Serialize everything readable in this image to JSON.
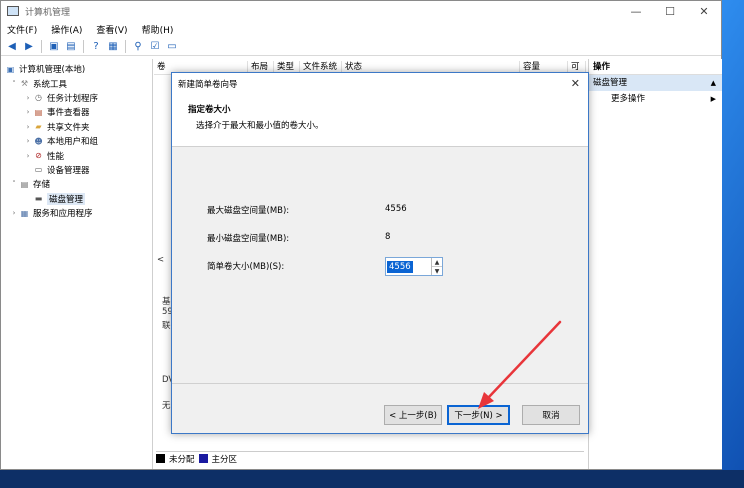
{
  "window": {
    "title": "计算机管理",
    "minimize": "—",
    "maximize": "☐",
    "close": "✕"
  },
  "menu": {
    "items": [
      "文件(F)",
      "操作(A)",
      "查看(V)",
      "帮助(H)"
    ]
  },
  "tree": {
    "items": [
      {
        "label": "计算机管理(本地)",
        "icon": "computer-icon",
        "level": 0,
        "arrow": ""
      },
      {
        "label": "系统工具",
        "icon": "tools-icon",
        "level": 1,
        "arrow": "˅"
      },
      {
        "label": "任务计划程序",
        "icon": "clock-icon",
        "level": 2,
        "arrow": "›"
      },
      {
        "label": "事件查看器",
        "icon": "event-icon",
        "level": 2,
        "arrow": "›"
      },
      {
        "label": "共享文件夹",
        "icon": "folder-icon",
        "level": 2,
        "arrow": "›"
      },
      {
        "label": "本地用户和组",
        "icon": "users-icon",
        "level": 2,
        "arrow": "›"
      },
      {
        "label": "性能",
        "icon": "performance-icon",
        "level": 2,
        "arrow": "›"
      },
      {
        "label": "设备管理器",
        "icon": "device-icon",
        "level": 2,
        "arrow": ""
      },
      {
        "label": "存储",
        "icon": "storage-icon",
        "level": 1,
        "arrow": "˅"
      },
      {
        "label": "磁盘管理",
        "icon": "disk-icon",
        "level": 2,
        "arrow": ""
      },
      {
        "label": "服务和应用程序",
        "icon": "services-icon",
        "level": 1,
        "arrow": "›"
      }
    ]
  },
  "center": {
    "columns": [
      "卷",
      "布局",
      "类型",
      "文件系统",
      "状态",
      "容量",
      "可"
    ],
    "fragments": {
      "left_arrow": "<",
      "disk_a": "基",
      "disk_b": "59",
      "disk_c": "联",
      "dvd": "DV",
      "none": "无"
    },
    "legend": {
      "unallocated": "未分配",
      "primary": "主分区",
      "unallocated_color": "#000000",
      "primary_color": "#1a1aa0"
    }
  },
  "actions": {
    "header": "操作",
    "section": "磁盘管理",
    "more": "更多操作"
  },
  "wizard": {
    "title": "新建简单卷向导",
    "heading": "指定卷大小",
    "subheading": "选择介于最大和最小值的卷大小。",
    "max_label": "最大磁盘空间量(MB):",
    "max_value": "4556",
    "min_label": "最小磁盘空间量(MB):",
    "min_value": "8",
    "size_label": "简单卷大小(MB)(S):",
    "size_value": "4556",
    "back_button": "< 上一步(B)",
    "next_button": "下一步(N) >",
    "cancel_button": "取消"
  },
  "desktop": {
    "frag1": "I",
    "frag2": "E",
    "frag3": "30"
  },
  "colors": {
    "accent": "#0a64d3",
    "annotation": "#e8353a"
  }
}
